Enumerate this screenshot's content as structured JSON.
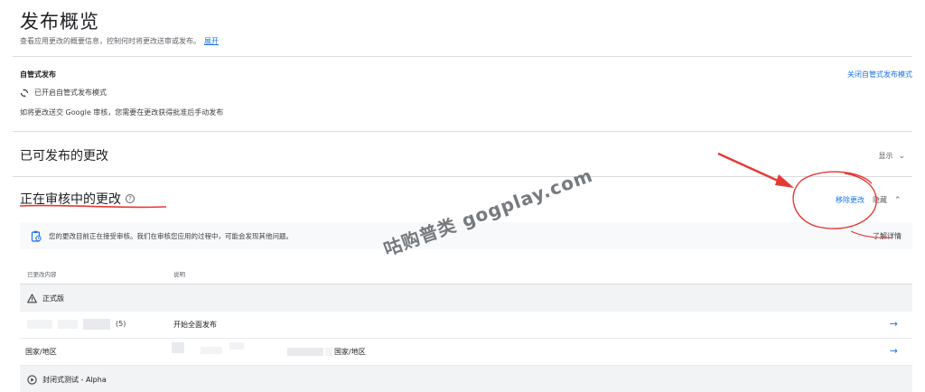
{
  "header": {
    "title": "发布概览",
    "subtitle": "查看应用更改的概要信息，控制何时将更改送审或发布。",
    "expand_label": "展开"
  },
  "managed_publishing": {
    "title": "自管式发布",
    "turn_off_label": "关闭自管式发布模式",
    "status_label": "已开启自管式发布模式",
    "description": "如将更改送交 Google 审核，您需要在更改获得批准后手动发布"
  },
  "ready_section": {
    "title": "已可发布的更改",
    "toggle_label": "显示"
  },
  "review_section": {
    "title": "正在审核中的更改",
    "help_glyph": "?",
    "remove_label": "移除更改",
    "hide_label": "隐藏",
    "notice_text": "您的更改目前正在接受审核。我们在审核您应用的过程中，可能会发现其他问题。",
    "learn_more_label": "了解详情",
    "columns": [
      "已更改内容",
      "说明"
    ],
    "groups": [
      {
        "icon": "warning-icon",
        "label": "正式版",
        "rows": [
          {
            "item_suffix": "(5)",
            "description": "开始全面发布"
          },
          {
            "item": "国家/地区",
            "description_suffix": "国家/地区"
          }
        ]
      },
      {
        "icon": "play-circle-icon",
        "label": "封闭式测试 - Alpha"
      }
    ]
  },
  "watermark": "咕购普类 gogplay.com",
  "colors": {
    "accent": "#1a73e8",
    "annotation": "#e53935",
    "group_bg": "#f1f3f4"
  }
}
